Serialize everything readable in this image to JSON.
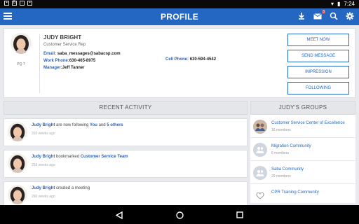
{
  "status_bar": {
    "time": "7:24"
  },
  "app_bar": {
    "title": "PROFILE",
    "notification_count": "3"
  },
  "profile": {
    "name": "JUDY BRIGHT",
    "role": "Customer Service Rep",
    "pq_label": "PQ 7",
    "email_label": "Email:",
    "email": "saba_messages@sabacsp.com",
    "work_phone_label": "Work Phone:",
    "work_phone": "630-465-8975",
    "cell_phone_label": "Cell Phone:",
    "cell_phone": "630-594-4542",
    "manager_label": "Manager:",
    "manager": "Jeff Tanner",
    "actions": [
      "MEET NOW",
      "SEND MESSAGE",
      "IMPRESSION",
      "FOLLOWING"
    ]
  },
  "activity": {
    "header": "RECENT ACTIVITY",
    "items": [
      {
        "actor": "Judy Bright",
        "text1": " are now following ",
        "obj1": "You",
        "text2": " and ",
        "obj2": "5 others",
        "time": "310 weeks ago"
      },
      {
        "actor": "Judy Bright",
        "text1": " bookmarked ",
        "obj1": "Customer Service Team",
        "text2": "",
        "obj2": "",
        "time": "259 weeks ago"
      },
      {
        "actor": "Judy Bright",
        "text1": " created a meeting",
        "obj1": "",
        "text2": "",
        "obj2": "",
        "time": "260 weeks ago"
      }
    ]
  },
  "groups": {
    "header": "JUDY'S GROUPS",
    "items": [
      {
        "name": "Customer Service Center of Excellence",
        "count": "16 members"
      },
      {
        "name": "Migration Community",
        "count": "6 members"
      },
      {
        "name": "Saba Community",
        "count": "29 members"
      },
      {
        "name": "CPR Training Community",
        "count": ""
      }
    ]
  },
  "colors": {
    "accent": "#2467c2",
    "link": "#2a63b8"
  }
}
